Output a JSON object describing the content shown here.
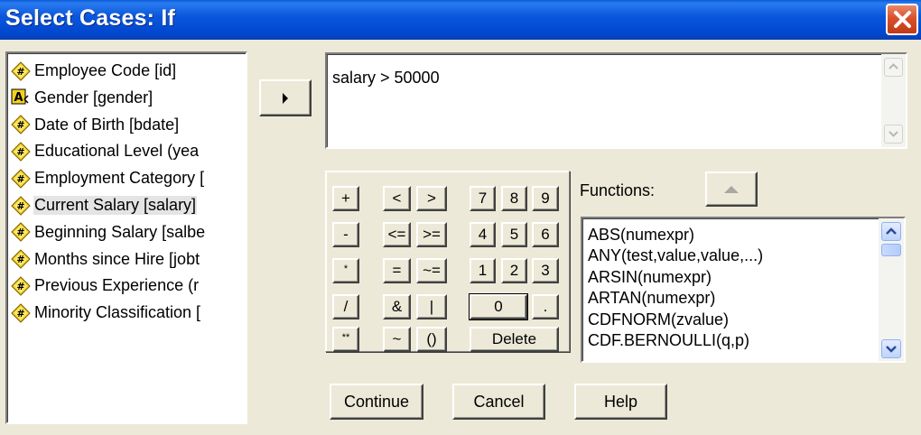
{
  "window": {
    "title": "Select Cases: If",
    "close_icon": "close-icon"
  },
  "variables": [
    {
      "label": "Employee Code [id]",
      "icon": "numeric-variable-icon",
      "selected": false
    },
    {
      "label": "Gender [gender]",
      "icon": "string-variable-icon",
      "selected": false
    },
    {
      "label": "Date of Birth [bdate]",
      "icon": "numeric-variable-icon",
      "selected": false
    },
    {
      "label": "Educational Level (yea",
      "icon": "numeric-variable-icon",
      "selected": false
    },
    {
      "label": "Employment Category [",
      "icon": "numeric-variable-icon",
      "selected": false
    },
    {
      "label": "Current Salary [salary]",
      "icon": "numeric-variable-icon",
      "selected": true
    },
    {
      "label": "Beginning Salary [salbe",
      "icon": "numeric-variable-icon",
      "selected": false
    },
    {
      "label": "Months since Hire [jobt",
      "icon": "numeric-variable-icon",
      "selected": false
    },
    {
      "label": "Previous Experience (r",
      "icon": "numeric-variable-icon",
      "selected": false
    },
    {
      "label": "Minority Classification [",
      "icon": "numeric-variable-icon",
      "selected": false
    }
  ],
  "move_button_icon": "right-arrow-icon",
  "expression": "salary > 50000",
  "calculator": {
    "keys": [
      "+",
      "<",
      ">",
      "7",
      "8",
      "9",
      "-",
      "<=",
      ">=",
      "4",
      "5",
      "6",
      "*",
      "=",
      "~=",
      "1",
      "2",
      "3",
      "/",
      "&",
      "|",
      "0",
      ".",
      "**",
      "~",
      "()",
      "Delete"
    ]
  },
  "functions": {
    "label": "Functions:",
    "up_icon": "up-arrow-icon",
    "items": [
      "ABS(numexpr)",
      "ANY(test,value,value,...)",
      "ARSIN(numexpr)",
      "ARTAN(numexpr)",
      "CDFNORM(zvalue)",
      "CDF.BERNOULLI(q,p)"
    ]
  },
  "buttons": {
    "continue": "Continue",
    "cancel": "Cancel",
    "help": "Help"
  }
}
